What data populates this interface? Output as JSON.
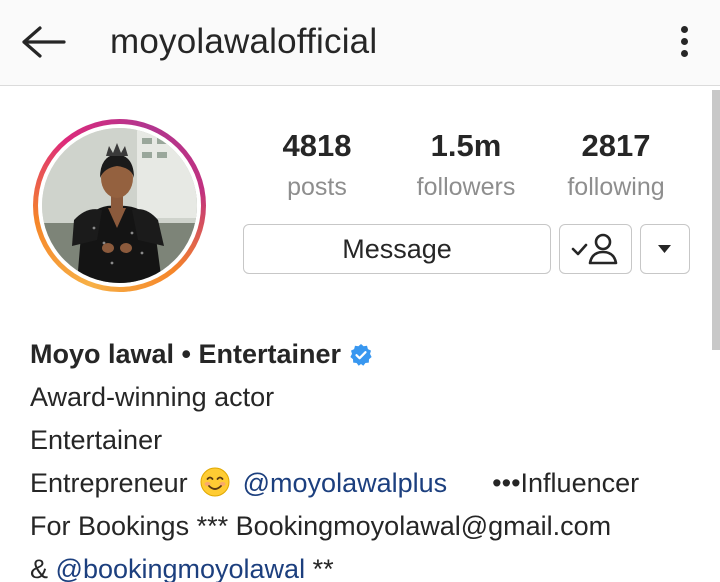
{
  "header": {
    "title": "moyolawalofficial"
  },
  "stats": {
    "posts": {
      "value": "4818",
      "label": "posts"
    },
    "followers": {
      "value": "1.5m",
      "label": "followers"
    },
    "following": {
      "value": "2817",
      "label": "following"
    }
  },
  "actions": {
    "message_label": "Message"
  },
  "bio": {
    "name": "Moyo lawal • Entertainer",
    "line1": "Award-winning actor",
    "line2": "Entertainer",
    "line3_text": "Entrepreneur",
    "line3_mention": "@moyolawalplus",
    "line3_tail": "•••Influencer",
    "line4": "For Bookings *** Bookingmoyolawal@gmail.com",
    "line5_prefix": "&",
    "line5_mention": "@bookingmoyolawal",
    "line5_suffix": "**"
  },
  "colors": {
    "verified": "#3897f0",
    "mention": "#1c3f7e",
    "ring_start": "#f58529",
    "ring_end": "#dd2a7b"
  },
  "icons": {
    "back": "arrow-left-icon",
    "more": "vertical-dots-icon",
    "following": "person-check-icon",
    "dropdown": "caret-down-icon",
    "verified": "verified-badge-icon",
    "emoji": "smiling-face-emoji"
  }
}
